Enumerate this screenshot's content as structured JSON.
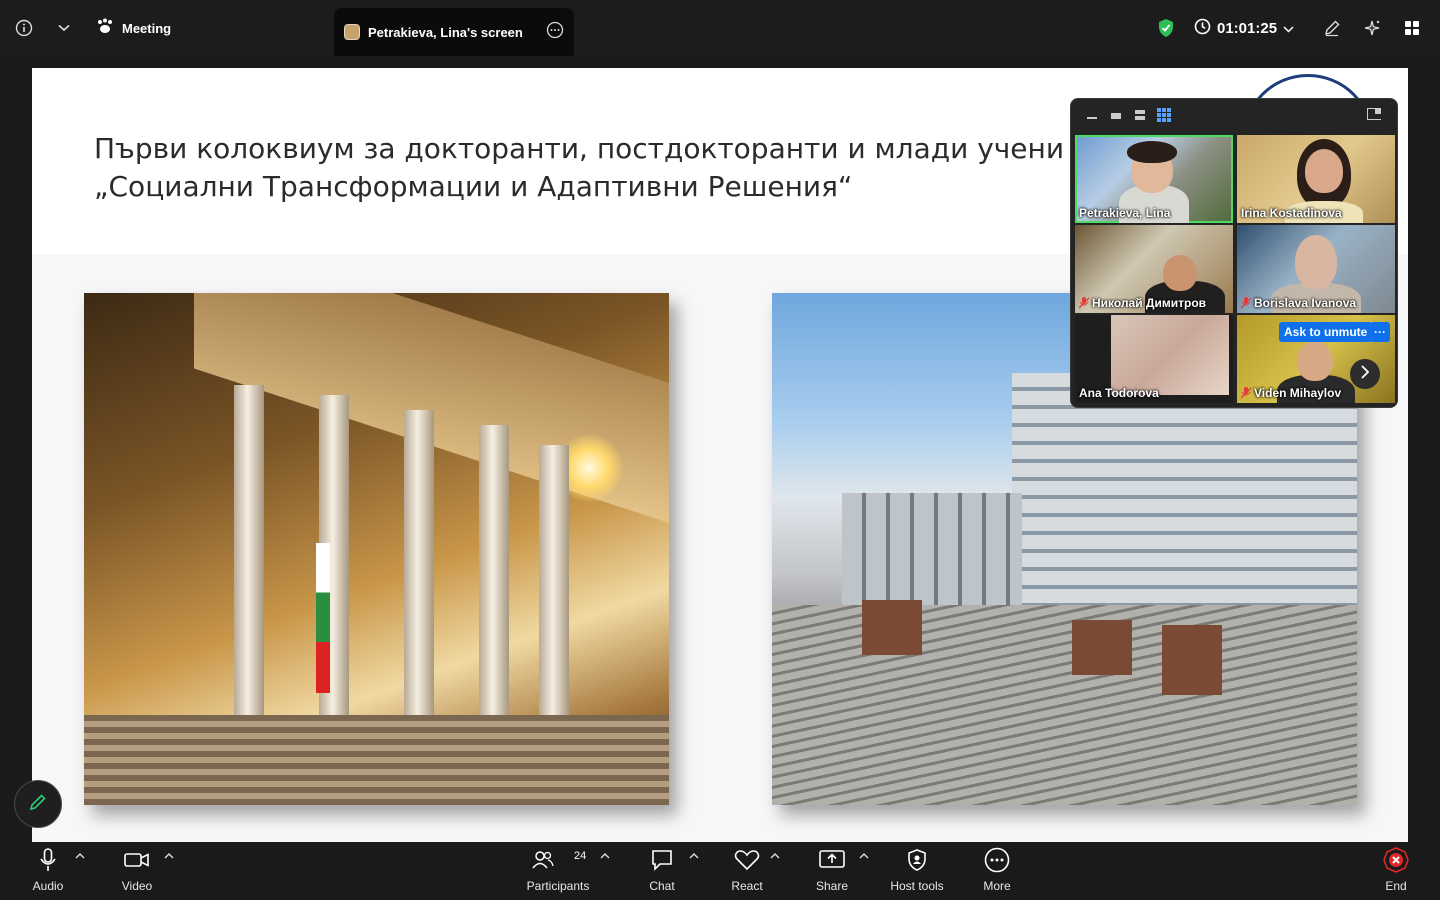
{
  "topbar": {
    "meeting_label": "Meeting",
    "screen_tab_label": "Petrakieva, Lina's screen",
    "timer": "01:01:25",
    "security_color": "#2ebd59"
  },
  "slide": {
    "title_line1": "Първи колоквиум за докторанти, постдокторанти и млади учени",
    "title_line2": "„Социални Трансформации и Адаптивни Решения“"
  },
  "gallery": {
    "participants": [
      {
        "name": "Petrakieva, Lina",
        "muted": false,
        "active": true
      },
      {
        "name": "Irina Kostadinova",
        "muted": false,
        "active": false
      },
      {
        "name": "Николай Димитров",
        "muted": true,
        "active": false
      },
      {
        "name": "Borislava Ivanova",
        "muted": true,
        "active": false
      },
      {
        "name": "Ana Todorova",
        "muted": false,
        "active": false
      },
      {
        "name": "Viden Mihaylov",
        "muted": true,
        "active": false
      }
    ],
    "ask_to_unmute_label": "Ask to unmute",
    "more_label": "···"
  },
  "toolbar": {
    "audio": "Audio",
    "video": "Video",
    "participants": "Participants",
    "participants_count": "24",
    "chat": "Chat",
    "react": "React",
    "share": "Share",
    "host_tools": "Host tools",
    "more": "More",
    "end": "End",
    "end_color": "#e02828"
  }
}
